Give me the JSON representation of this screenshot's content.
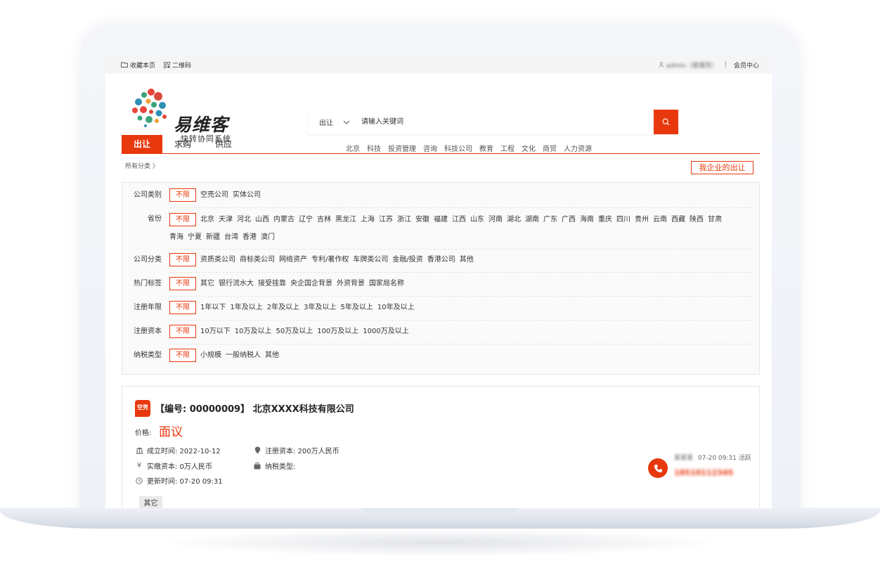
{
  "topbar": {
    "bookmark": "收藏本页",
    "qrcode": "二维码",
    "user": "admin（管理员）",
    "separator": "|",
    "member_center": "会员中心"
  },
  "logo": {
    "title": "易维客",
    "subtitle": "快转协同系统"
  },
  "search": {
    "type": "出让",
    "placeholder": "请输入关键词"
  },
  "hotwords": [
    "北京",
    "科技",
    "投资管理",
    "咨询",
    "科技公司",
    "教育",
    "工程",
    "文化",
    "商贸",
    "人力资源"
  ],
  "tabs": [
    {
      "label": "出让",
      "active": true
    },
    {
      "label": "求购",
      "active": false
    },
    {
      "label": "供应",
      "active": false
    }
  ],
  "breadcrumb": "所有分类 〉",
  "my_listings_button": "我企业的出让",
  "filters": {
    "nolimit_label": "不限",
    "rows": [
      {
        "label": "公司类别",
        "options": [
          "空壳公司",
          "实体公司"
        ]
      },
      {
        "label": "省份",
        "options": [
          "北京",
          "天津",
          "河北",
          "山西",
          "内蒙古",
          "辽宁",
          "吉林",
          "黑龙江",
          "上海",
          "江苏",
          "浙江",
          "安徽",
          "福建",
          "江西",
          "山东",
          "河南",
          "湖北",
          "湖南",
          "广东",
          "广西",
          "海南",
          "重庆",
          "四川",
          "贵州",
          "云南",
          "西藏",
          "陕西",
          "甘肃",
          "青海",
          "宁夏",
          "新疆",
          "台湾",
          "香港",
          "澳门"
        ]
      },
      {
        "label": "公司分类",
        "options": [
          "资质类公司",
          "商标类公司",
          "网络资产",
          "专利/著作权",
          "车牌类公司",
          "金融/投资",
          "香港公司",
          "其他"
        ]
      },
      {
        "label": "热门标签",
        "options": [
          "其它",
          "银行流水大",
          "接受挂靠",
          "央企国企背景",
          "外资背景",
          "国家局名称"
        ]
      },
      {
        "label": "注册年限",
        "options": [
          "1年以下",
          "1年及以上",
          "2年及以上",
          "3年及以上",
          "5年及以上",
          "10年及以上"
        ]
      },
      {
        "label": "注册资本",
        "options": [
          "10万以下",
          "10万及以上",
          "50万及以上",
          "100万及以上",
          "1000万及以上"
        ]
      },
      {
        "label": "纳税类型",
        "options": [
          "小规模",
          "一般纳税人",
          "其他"
        ]
      }
    ]
  },
  "listing": {
    "badge": "空壳",
    "title": "【编号: 00000009】 北京XXXX科技有限公司",
    "price_label": "价格:",
    "price": "面议",
    "established": "成立时间:   2022-10-12",
    "paid_capital": "实缴资本: 0万人民币",
    "updated": "更新时间: 07-20 09:31",
    "registered_capital": "注册资本: 200万人民币",
    "tax_type": "纳税类型:",
    "tag": "其它",
    "contact_name": "某某某",
    "contact_time": "07-20 09:31 活跃",
    "contact_phone": "18510112345"
  },
  "colors": {
    "accent": "#e8380d",
    "topbar_bg": "#f5f5f5",
    "panel_bg": "#fafafa"
  }
}
